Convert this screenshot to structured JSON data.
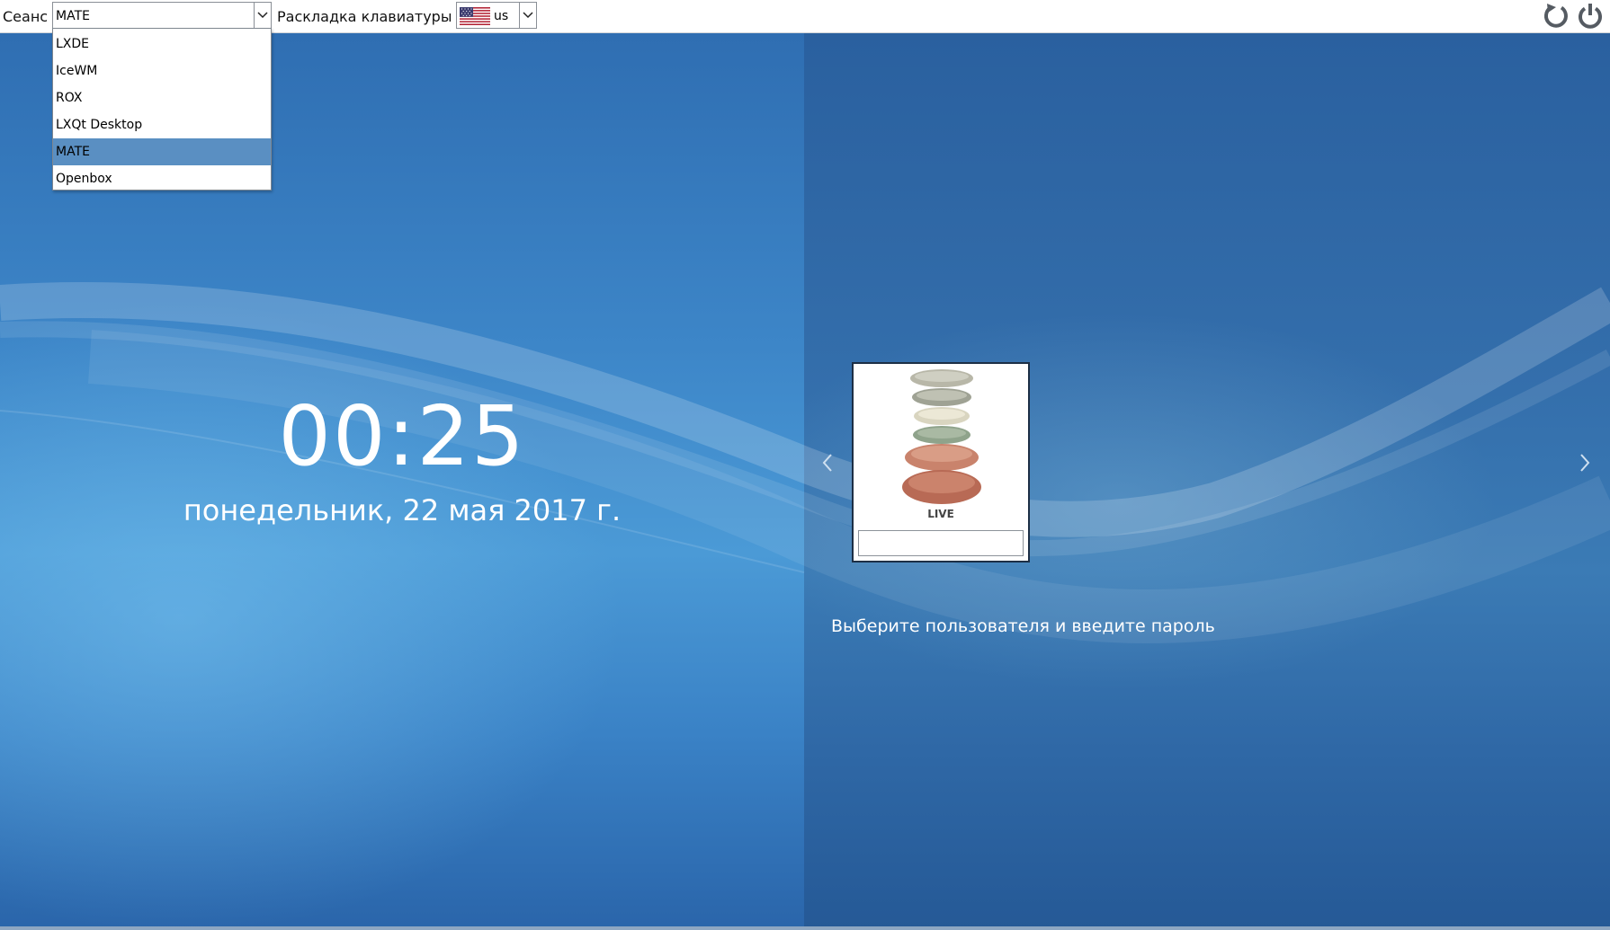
{
  "topbar": {
    "session_label": "Сеанс",
    "session_value": "MATE",
    "keyboard_label": "Раскладка клавиатуры",
    "keyboard_value": "us",
    "keyboard_flag": "us-flag-icon"
  },
  "session_menu": {
    "items": [
      "LXDE",
      "IceWM",
      "ROX",
      "LXQt Desktop",
      "MATE",
      "Openbox"
    ],
    "selected": "MATE"
  },
  "clock": {
    "time": "00:25",
    "date": "понедельник, 22 мая 2017 г."
  },
  "login": {
    "user_name": "LIVE",
    "password_value": "",
    "hint": "Выберите пользователя и введите пароль"
  },
  "icons": {
    "restart": "restart-icon",
    "shutdown": "power-icon",
    "prev": "chevron-left-icon",
    "next": "chevron-right-icon"
  },
  "colors": {
    "selection": "#5a8fc2",
    "background": "#2a64a0"
  }
}
